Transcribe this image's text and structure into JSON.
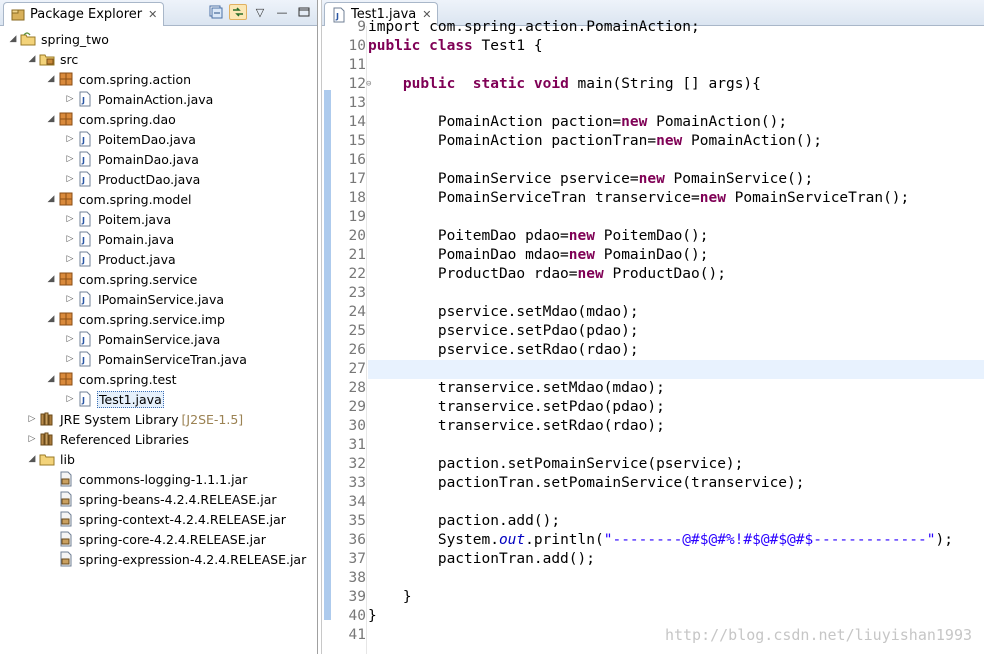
{
  "explorer": {
    "tab_label": "Package Explorer",
    "close_glyph": "✕",
    "toolbar": [
      "collapse-all-icon",
      "link-with-editor-icon",
      "view-menu-icon",
      "minimize-icon",
      "maximize-icon"
    ],
    "tree": [
      {
        "indent": 0,
        "toggle": "open",
        "icon": "project-icon",
        "label": "spring_two"
      },
      {
        "indent": 1,
        "toggle": "open",
        "icon": "source-folder-icon",
        "label": "src"
      },
      {
        "indent": 2,
        "toggle": "open",
        "icon": "package-icon",
        "label": "com.spring.action"
      },
      {
        "indent": 3,
        "toggle": "closed",
        "icon": "java-file-icon",
        "label": "PomainAction.java"
      },
      {
        "indent": 2,
        "toggle": "open",
        "icon": "package-icon",
        "label": "com.spring.dao"
      },
      {
        "indent": 3,
        "toggle": "closed",
        "icon": "java-file-icon",
        "label": "PoitemDao.java"
      },
      {
        "indent": 3,
        "toggle": "closed",
        "icon": "java-file-icon",
        "label": "PomainDao.java"
      },
      {
        "indent": 3,
        "toggle": "closed",
        "icon": "java-file-icon",
        "label": "ProductDao.java"
      },
      {
        "indent": 2,
        "toggle": "open",
        "icon": "package-icon",
        "label": "com.spring.model"
      },
      {
        "indent": 3,
        "toggle": "closed",
        "icon": "java-file-icon",
        "label": "Poitem.java"
      },
      {
        "indent": 3,
        "toggle": "closed",
        "icon": "java-file-icon",
        "label": "Pomain.java"
      },
      {
        "indent": 3,
        "toggle": "closed",
        "icon": "java-file-icon",
        "label": "Product.java"
      },
      {
        "indent": 2,
        "toggle": "open",
        "icon": "package-icon",
        "label": "com.spring.service"
      },
      {
        "indent": 3,
        "toggle": "closed",
        "icon": "java-file-icon",
        "label": "IPomainService.java"
      },
      {
        "indent": 2,
        "toggle": "open",
        "icon": "package-icon",
        "label": "com.spring.service.imp"
      },
      {
        "indent": 3,
        "toggle": "closed",
        "icon": "java-file-icon",
        "label": "PomainService.java"
      },
      {
        "indent": 3,
        "toggle": "closed",
        "icon": "java-file-icon",
        "label": "PomainServiceTran.java"
      },
      {
        "indent": 2,
        "toggle": "open",
        "icon": "package-icon",
        "label": "com.spring.test"
      },
      {
        "indent": 3,
        "toggle": "closed",
        "icon": "java-file-icon",
        "label": "Test1.java",
        "selected": true
      },
      {
        "indent": 1,
        "toggle": "closed",
        "icon": "library-icon",
        "label": "JRE System Library",
        "decoration": "[J2SE-1.5]"
      },
      {
        "indent": 1,
        "toggle": "closed",
        "icon": "library-icon",
        "label": "Referenced Libraries"
      },
      {
        "indent": 1,
        "toggle": "open",
        "icon": "folder-icon",
        "label": "lib"
      },
      {
        "indent": 2,
        "toggle": "none",
        "icon": "jar-icon",
        "label": "commons-logging-1.1.1.jar"
      },
      {
        "indent": 2,
        "toggle": "none",
        "icon": "jar-icon",
        "label": "spring-beans-4.2.4.RELEASE.jar"
      },
      {
        "indent": 2,
        "toggle": "none",
        "icon": "jar-icon",
        "label": "spring-context-4.2.4.RELEASE.jar"
      },
      {
        "indent": 2,
        "toggle": "none",
        "icon": "jar-icon",
        "label": "spring-core-4.2.4.RELEASE.jar"
      },
      {
        "indent": 2,
        "toggle": "none",
        "icon": "jar-icon",
        "label": "spring-expression-4.2.4.RELEASE.jar"
      }
    ]
  },
  "editor": {
    "tab_label": "Test1.java",
    "close_glyph": "✕",
    "partial_top_line": "import com.spring.action.PomainAction;",
    "lines": [
      {
        "n": "9",
        "t": [
          [
            "",
            "import com.spring.action.PomainAction;"
          ]
        ]
      },
      {
        "n": "10",
        "t": [
          [
            "kw",
            "public"
          ],
          [
            "",
            " "
          ],
          [
            "kw",
            "class"
          ],
          [
            "",
            " Test1 {"
          ]
        ]
      },
      {
        "n": "11",
        "t": []
      },
      {
        "n": "12",
        "fold": true,
        "t": [
          [
            "",
            "    "
          ],
          [
            "kw",
            "public"
          ],
          [
            "",
            "  "
          ],
          [
            "kw",
            "static"
          ],
          [
            "",
            " "
          ],
          [
            "kw",
            "void"
          ],
          [
            "",
            " main(String [] args){"
          ]
        ]
      },
      {
        "n": "13",
        "t": []
      },
      {
        "n": "14",
        "t": [
          [
            "",
            "        PomainAction paction="
          ],
          [
            "kw",
            "new"
          ],
          [
            "",
            " PomainAction();"
          ]
        ]
      },
      {
        "n": "15",
        "t": [
          [
            "",
            "        PomainAction pactionTran="
          ],
          [
            "kw",
            "new"
          ],
          [
            "",
            " PomainAction();"
          ]
        ]
      },
      {
        "n": "16",
        "t": []
      },
      {
        "n": "17",
        "t": [
          [
            "",
            "        PomainService pservice="
          ],
          [
            "kw",
            "new"
          ],
          [
            "",
            " PomainService();"
          ]
        ]
      },
      {
        "n": "18",
        "t": [
          [
            "",
            "        PomainServiceTran transervice="
          ],
          [
            "kw",
            "new"
          ],
          [
            "",
            " PomainServiceTran();"
          ]
        ]
      },
      {
        "n": "19",
        "t": []
      },
      {
        "n": "20",
        "t": [
          [
            "",
            "        PoitemDao pdao="
          ],
          [
            "kw",
            "new"
          ],
          [
            "",
            " PoitemDao();"
          ]
        ]
      },
      {
        "n": "21",
        "t": [
          [
            "",
            "        PomainDao mdao="
          ],
          [
            "kw",
            "new"
          ],
          [
            "",
            " PomainDao();"
          ]
        ]
      },
      {
        "n": "22",
        "t": [
          [
            "",
            "        ProductDao rdao="
          ],
          [
            "kw",
            "new"
          ],
          [
            "",
            " ProductDao();"
          ]
        ]
      },
      {
        "n": "23",
        "t": []
      },
      {
        "n": "24",
        "t": [
          [
            "",
            "        pservice.setMdao(mdao);"
          ]
        ]
      },
      {
        "n": "25",
        "t": [
          [
            "",
            "        pservice.setPdao(pdao);"
          ]
        ]
      },
      {
        "n": "26",
        "t": [
          [
            "",
            "        pservice.setRdao(rdao);"
          ]
        ]
      },
      {
        "n": "27",
        "hl": true,
        "t": []
      },
      {
        "n": "28",
        "t": [
          [
            "",
            "        transervice.setMdao(mdao);"
          ]
        ]
      },
      {
        "n": "29",
        "t": [
          [
            "",
            "        transervice.setPdao(pdao);"
          ]
        ]
      },
      {
        "n": "30",
        "t": [
          [
            "",
            "        transervice.setRdao(rdao);"
          ]
        ]
      },
      {
        "n": "31",
        "t": []
      },
      {
        "n": "32",
        "t": [
          [
            "",
            "        paction.setPomainService(pservice);"
          ]
        ]
      },
      {
        "n": "33",
        "t": [
          [
            "",
            "        pactionTran.setPomainService(transervice);"
          ]
        ]
      },
      {
        "n": "34",
        "t": []
      },
      {
        "n": "35",
        "t": [
          [
            "",
            "        paction.add();"
          ]
        ]
      },
      {
        "n": "36",
        "t": [
          [
            "",
            "        System."
          ],
          [
            "it",
            "out"
          ],
          [
            "",
            ".println("
          ],
          [
            "st",
            "\"--------@#$@#%!#$@#$@#$-------------\""
          ],
          [
            "",
            ");"
          ]
        ]
      },
      {
        "n": "37",
        "t": [
          [
            "",
            "        pactionTran.add();"
          ]
        ]
      },
      {
        "n": "38",
        "t": []
      },
      {
        "n": "39",
        "t": [
          [
            "",
            "    }"
          ]
        ]
      },
      {
        "n": "40",
        "t": [
          [
            "",
            "}"
          ]
        ]
      },
      {
        "n": "41",
        "t": []
      }
    ]
  },
  "watermark": "http://blog.csdn.net/liuyishan1993"
}
